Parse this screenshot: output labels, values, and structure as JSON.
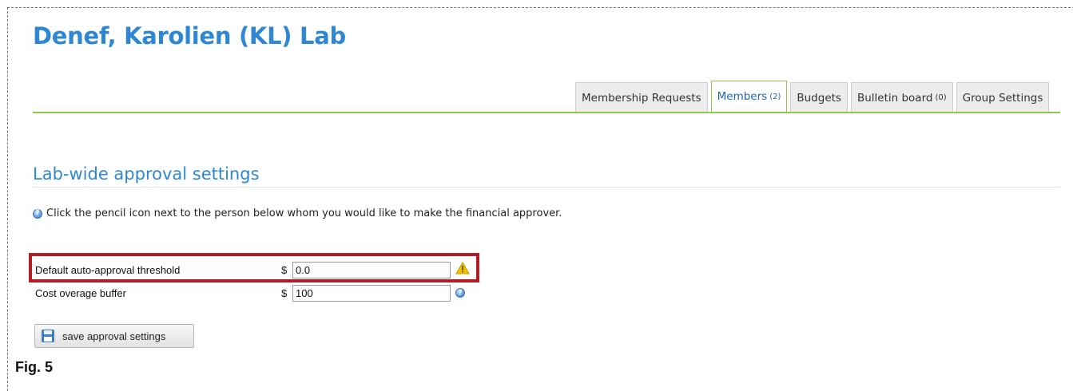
{
  "header": {
    "lab_title": "Denef, Karolien (KL) Lab"
  },
  "tabs": [
    {
      "label": "Membership Requests",
      "count": ""
    },
    {
      "label": "Members",
      "count": "(2)",
      "active": true
    },
    {
      "label": "Budgets",
      "count": ""
    },
    {
      "label": "Bulletin board",
      "count": "(0)"
    },
    {
      "label": "Group Settings",
      "count": ""
    }
  ],
  "section": {
    "title": "Lab-wide approval settings",
    "help_text": "Click the pencil icon next to the person below whom you would like to make the financial approver.",
    "help_icon": "info-icon"
  },
  "settings": {
    "auto_approval": {
      "label": "Default auto-approval threshold",
      "currency": "$",
      "value": "0.0",
      "icon": "warning-icon"
    },
    "overage_buffer": {
      "label": "Cost overage buffer",
      "currency": "$",
      "value": "100",
      "icon": "info-icon"
    }
  },
  "save_button": {
    "label": "save approval settings",
    "icon": "floppy-disk-icon"
  },
  "figure": {
    "label": "Fig. 5"
  },
  "colors": {
    "title_blue": "#2f86d2",
    "tab_green": "#8cc84b",
    "highlight_red": "#b11d23",
    "warning_yellow": "#f2c200"
  }
}
